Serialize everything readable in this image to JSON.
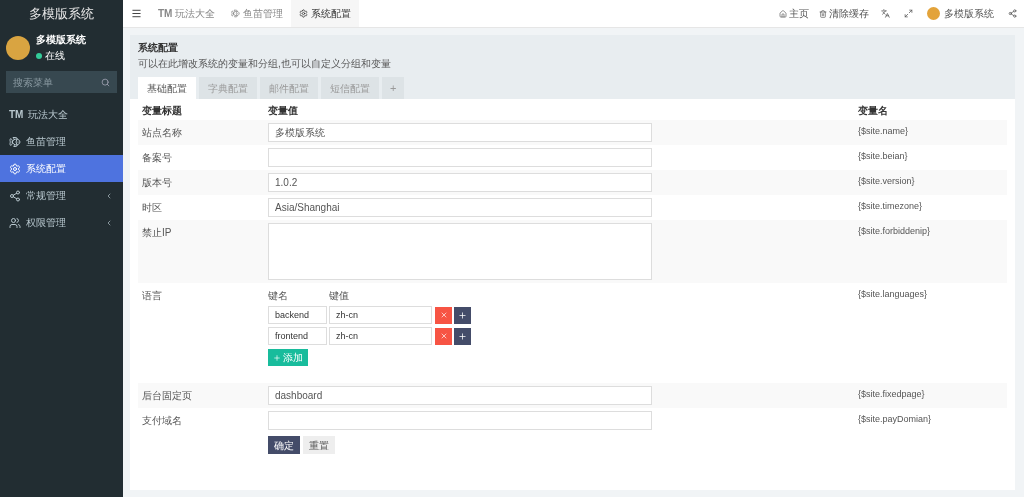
{
  "sidebar": {
    "title": "多模版系统",
    "user": {
      "name": "多模版系统",
      "status": "在线"
    },
    "search": {
      "placeholder": "搜索菜单"
    },
    "items": [
      {
        "icon": "TM",
        "label": "玩法大全",
        "selected": false,
        "expandable": false
      },
      {
        "label": "鱼苗管理",
        "selected": false,
        "expandable": false
      },
      {
        "label": "系统配置",
        "selected": true,
        "expandable": false
      },
      {
        "label": "常规管理",
        "selected": false,
        "expandable": true
      },
      {
        "label": "权限管理",
        "selected": false,
        "expandable": true
      }
    ]
  },
  "topbar": {
    "tabs": [
      {
        "icon": "TM",
        "label": "玩法大全",
        "selected": false
      },
      {
        "label": "鱼苗管理",
        "selected": false
      },
      {
        "label": "系统配置",
        "selected": true
      }
    ],
    "links": [
      "主页",
      "清除缓存"
    ],
    "user": "多模版系统"
  },
  "panel": {
    "title": "系统配置",
    "description": "可以在此增改系统的变量和分组,也可以自定义分组和变量",
    "tabs": [
      {
        "label": "基础配置",
        "selected": true
      },
      {
        "label": "字典配置",
        "selected": false
      },
      {
        "label": "邮件配置",
        "selected": false
      },
      {
        "label": "短信配置",
        "selected": false
      }
    ],
    "add_tab": "+",
    "columns": [
      "变量标题",
      "变量值",
      "变量名"
    ],
    "rows": [
      {
        "kind": "text",
        "title": "站点名称",
        "value": "多模版系统",
        "variable": "{$site.name}"
      },
      {
        "kind": "text",
        "title": "备案号",
        "value": "",
        "variable": "{$site.beian}"
      },
      {
        "kind": "text",
        "title": "版本号",
        "value": "1.0.2",
        "variable": "{$site.version}"
      },
      {
        "kind": "text",
        "title": "时区",
        "value": "Asia/Shanghai",
        "variable": "{$site.timezone}"
      },
      {
        "kind": "textarea",
        "title": "禁止IP",
        "value": "",
        "variable": "{$site.forbiddenip}"
      },
      {
        "kind": "array",
        "title": "语言",
        "key_header": "键名",
        "value_header": "键值",
        "pairs": [
          {
            "key": "backend",
            "value": "zh-cn"
          },
          {
            "key": "frontend",
            "value": "zh-cn"
          }
        ],
        "add_button": "添加",
        "variable": "{$site.languages}"
      },
      {
        "kind": "text",
        "title": "后台固定页",
        "value": "dashboard",
        "variable": "{$site.fixedpage}"
      },
      {
        "kind": "text",
        "title": "支付域名",
        "value": "",
        "variable": "{$site.payDomian}"
      }
    ],
    "buttons": {
      "submit": "确定",
      "reset": "重置"
    }
  }
}
